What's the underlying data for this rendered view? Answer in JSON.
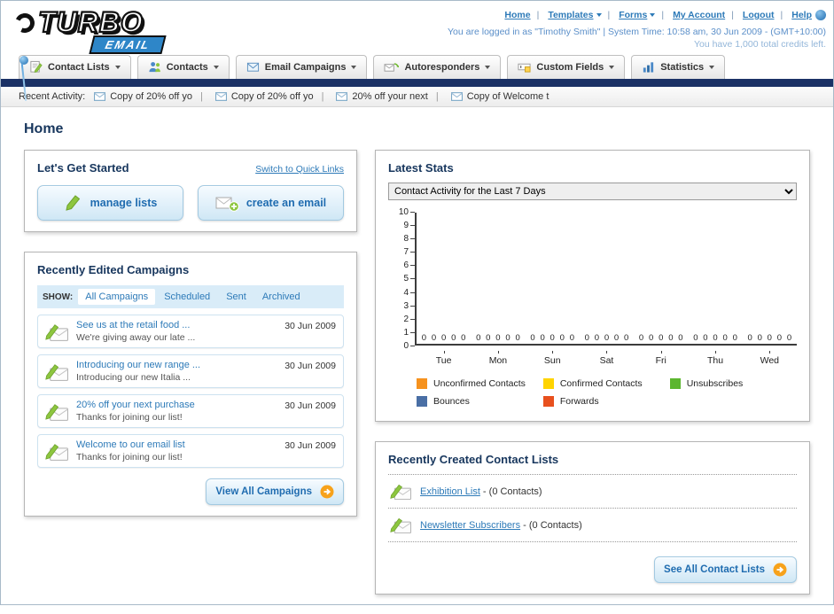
{
  "colors": {
    "accent_blue": "#2d7ab8",
    "navy_bar": "#1b3266",
    "orange": "#f7a21b",
    "button_blue_text": "#1f6cb0"
  },
  "icons": {
    "tab_icons": [
      "contact-lists-icon",
      "contacts-icon",
      "email-campaigns-icon",
      "autoresponders-icon",
      "custom-fields-icon",
      "statistics-icon"
    ],
    "list_item_icon": "envelope-pencil-icon",
    "button_arrow_icon": "orange-arrow-circle-icon"
  },
  "header": {
    "logo_title": "TURBO",
    "logo_subtitle": "EMAIL",
    "nav": [
      {
        "label": "Home",
        "dropdown": false
      },
      {
        "label": "Templates",
        "dropdown": true
      },
      {
        "label": "Forms",
        "dropdown": true
      },
      {
        "label": "My Account",
        "dropdown": false
      },
      {
        "label": "Logout",
        "dropdown": false
      },
      {
        "label": "Help",
        "dropdown": false
      }
    ],
    "login_line": "You are logged in as \"Timothy Smith\" | System Time: 10:58 am, 30 Jun 2009 - (GMT+10:00)",
    "credits_line": "You have 1,000 total credits left."
  },
  "tabs": [
    {
      "label": "Contact Lists"
    },
    {
      "label": "Contacts"
    },
    {
      "label": "Email Campaigns"
    },
    {
      "label": "Autoresponders"
    },
    {
      "label": "Custom Fields"
    },
    {
      "label": "Statistics"
    }
  ],
  "recent_activity": {
    "label": "Recent Activity:",
    "items": [
      "Copy of 20% off yo",
      "Copy of 20% off yo",
      "20% off your next",
      "Copy of Welcome t"
    ]
  },
  "page_title": "Home",
  "get_started": {
    "title": "Let's Get Started",
    "switch_link": "Switch to Quick Links",
    "manage_lists_label": "manage lists",
    "create_email_label": "create an email"
  },
  "campaigns": {
    "title": "Recently Edited Campaigns",
    "show_label": "SHOW:",
    "filters": [
      "All Campaigns",
      "Scheduled",
      "Sent",
      "Archived"
    ],
    "active_filter": "All Campaigns",
    "items": [
      {
        "title": "See us at the retail food ...",
        "subtitle": "We're giving away our late ...",
        "date": "30 Jun 2009"
      },
      {
        "title": "Introducing our new range ...",
        "subtitle": "Introducing our new Italia ...",
        "date": "30 Jun 2009"
      },
      {
        "title": "20% off your next purchase",
        "subtitle": "Thanks for joining our list!",
        "date": "30 Jun 2009"
      },
      {
        "title": "Welcome to our email list",
        "subtitle": "Thanks for joining our list!",
        "date": "30 Jun 2009"
      }
    ],
    "view_all_label": "View All Campaigns"
  },
  "stats": {
    "title": "Latest Stats",
    "selected_option": "Contact Activity for the Last 7 Days"
  },
  "chart_data": {
    "type": "bar",
    "title": "Contact Activity for the Last 7 Days",
    "categories": [
      "Tue",
      "Mon",
      "Sun",
      "Sat",
      "Fri",
      "Thu",
      "Wed"
    ],
    "series": [
      {
        "name": "Unconfirmed Contacts",
        "color": "#f6921e",
        "values": [
          0,
          0,
          0,
          0,
          0,
          0,
          0
        ]
      },
      {
        "name": "Confirmed Contacts",
        "color": "#ffd400",
        "values": [
          0,
          0,
          0,
          0,
          0,
          0,
          0
        ]
      },
      {
        "name": "Unsubscribes",
        "color": "#5cb62f",
        "values": [
          0,
          0,
          0,
          0,
          0,
          0,
          0
        ]
      },
      {
        "name": "Bounces",
        "color": "#4a6fa5",
        "values": [
          0,
          0,
          0,
          0,
          0,
          0,
          0
        ]
      },
      {
        "name": "Forwards",
        "color": "#e8501e",
        "values": [
          0,
          0,
          0,
          0,
          0,
          0,
          0
        ]
      }
    ],
    "ylim": [
      0,
      10
    ],
    "ytick_step": 1,
    "grid": false,
    "value_labels": true,
    "legend_position": "bottom"
  },
  "contact_lists": {
    "title": "Recently Created Contact Lists",
    "items": [
      {
        "name": "Exhibition List",
        "suffix": " - (0 Contacts)"
      },
      {
        "name": "Newsletter Subscribers",
        "suffix": " - (0 Contacts)"
      }
    ],
    "see_all_label": "See All Contact Lists"
  }
}
